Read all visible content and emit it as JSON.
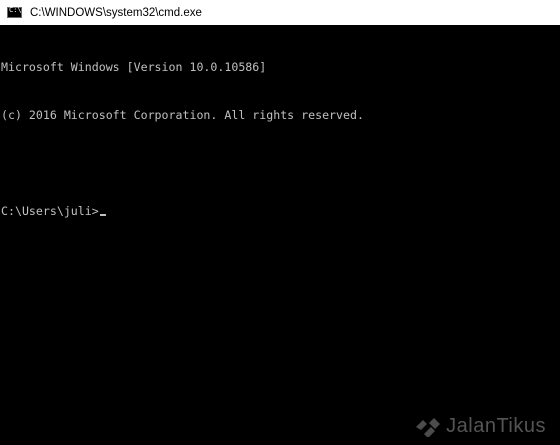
{
  "window": {
    "title": "C:\\WINDOWS\\system32\\cmd.exe",
    "icon": "cmd-icon"
  },
  "console": {
    "lines": [
      "Microsoft Windows [Version 10.0.10586]",
      "(c) 2016 Microsoft Corporation. All rights reserved.",
      "",
      "C:\\Users\\juli>"
    ],
    "text_color": "#c0c0c0",
    "background_color": "#000000"
  },
  "watermark": {
    "text": "JalanTikus"
  }
}
